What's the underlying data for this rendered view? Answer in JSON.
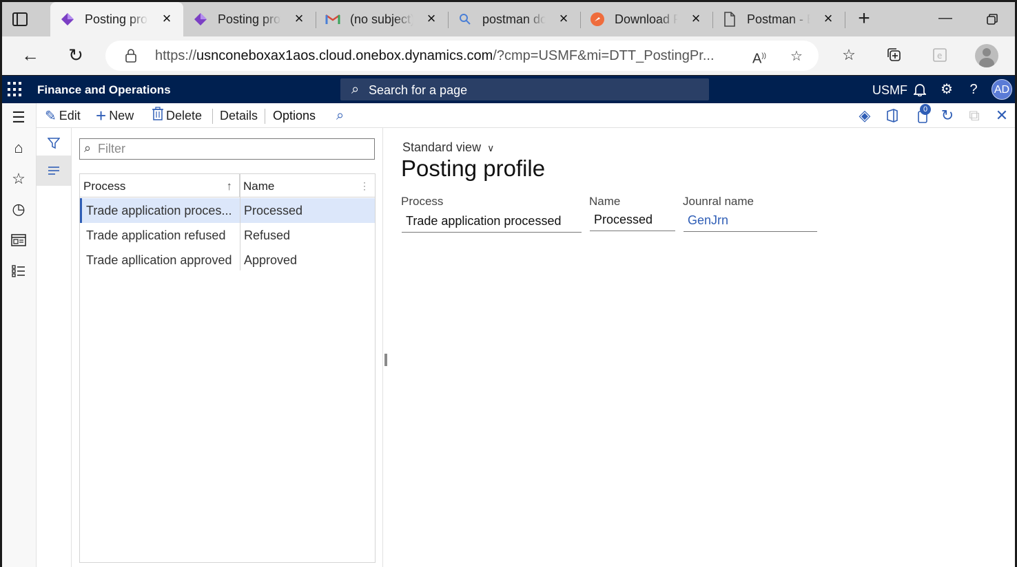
{
  "browser": {
    "tabs": [
      {
        "title": "Posting profile",
        "favicon": "d365-icon",
        "active": true
      },
      {
        "title": "Posting profile",
        "favicon": "d365-icon",
        "active": false
      },
      {
        "title": "(no subject)",
        "favicon": "gmail-icon",
        "active": false
      },
      {
        "title": "postman download",
        "favicon": "search-icon",
        "active": false
      },
      {
        "title": "Download Postman",
        "favicon": "postman-icon",
        "active": false
      },
      {
        "title": "Postman - Blank",
        "favicon": "page-icon",
        "active": false
      }
    ],
    "url_host": "usnconeboxax1aos.cloud.onebox.dynamics.com",
    "url_prefix": "https://",
    "url_rest": "/?cmp=USMF&mi=DTT_PostingPr..."
  },
  "app": {
    "name": "Finance and Operations",
    "search_placeholder": "Search for a page",
    "company": "USMF",
    "user_initials": "AD"
  },
  "actions": {
    "edit": "Edit",
    "new": "New",
    "delete": "Delete",
    "details": "Details",
    "options": "Options",
    "notification_count": "0"
  },
  "list": {
    "filter_placeholder": "Filter",
    "columns": [
      "Process",
      "Name"
    ],
    "rows": [
      {
        "process": "Trade application proces...",
        "name": "Processed",
        "selected": true
      },
      {
        "process": "Trade application refused",
        "name": "Refused",
        "selected": false
      },
      {
        "process": "Trade apllication approved",
        "name": "Approved",
        "selected": false
      }
    ]
  },
  "details": {
    "view": "Standard view",
    "title": "Posting profile",
    "fields": {
      "process_label": "Process",
      "process_value": "Trade application processed",
      "name_label": "Name",
      "name_value": "Processed",
      "journal_label": "Jounral name",
      "journal_value": "GenJrn"
    }
  },
  "colors": {
    "header_bg": "#002050",
    "accent": "#2f5eb6",
    "selected_row": "#dce7fa"
  }
}
